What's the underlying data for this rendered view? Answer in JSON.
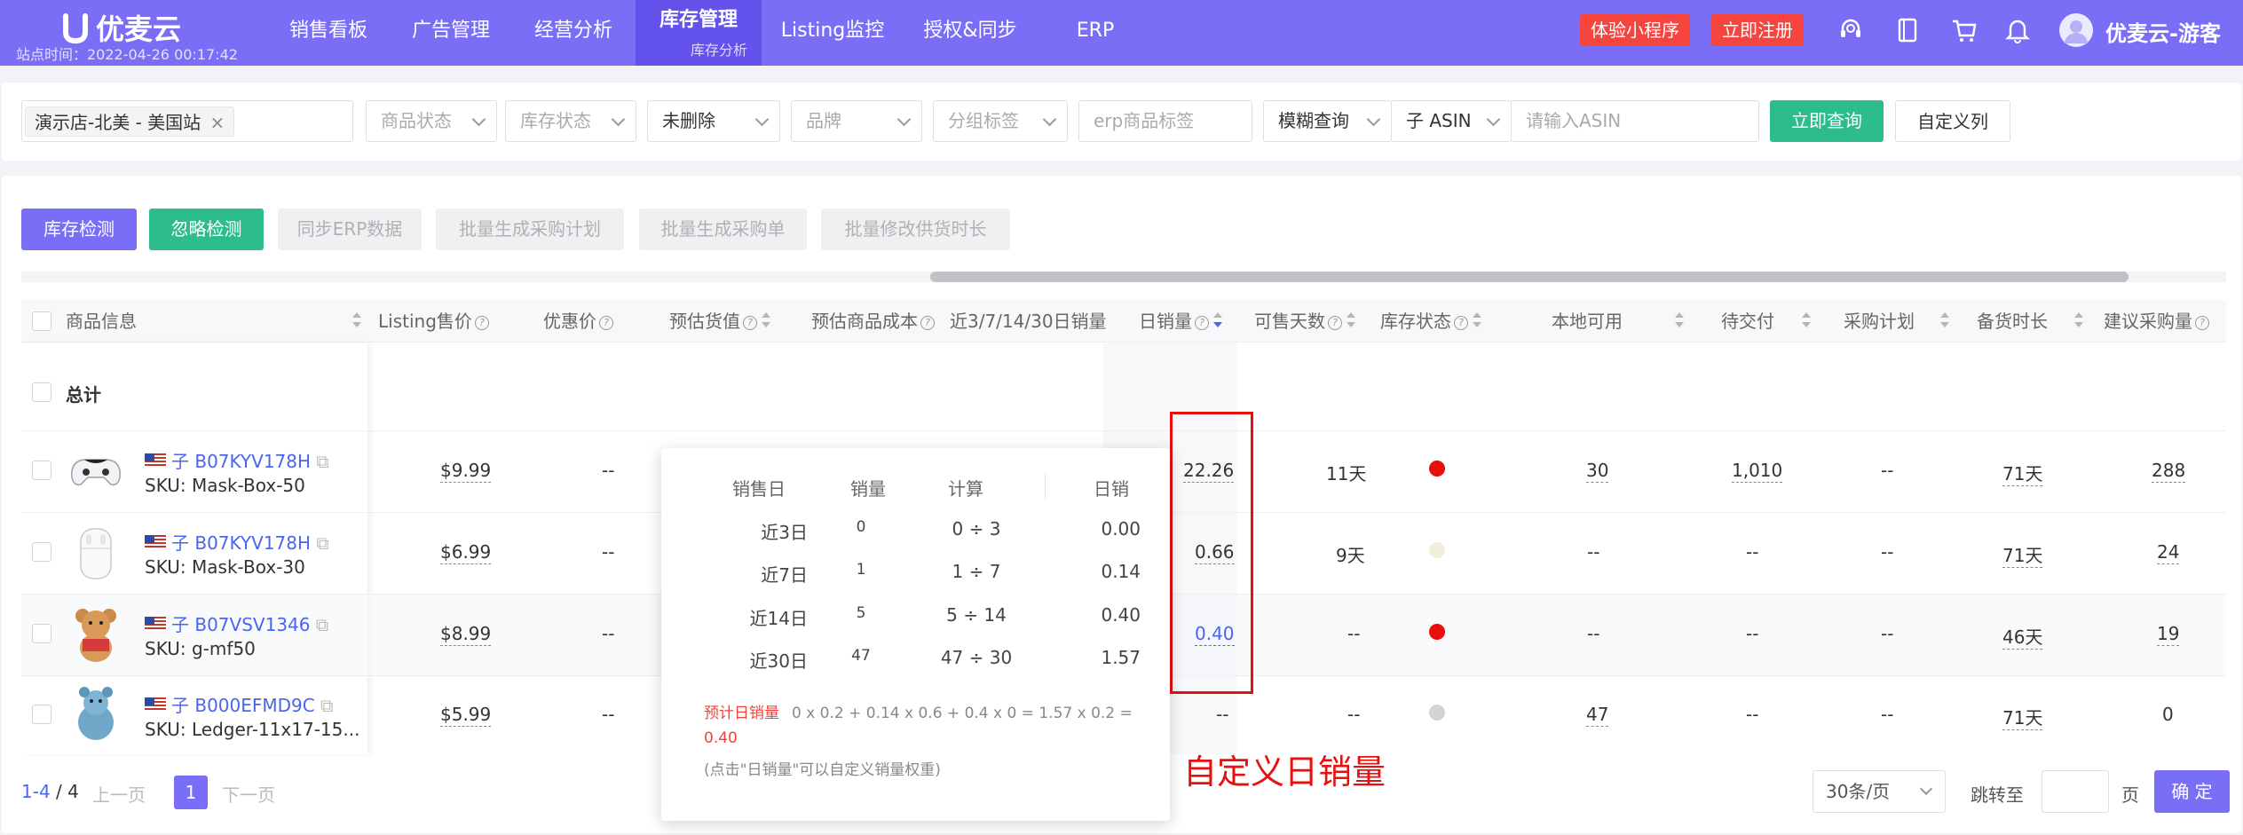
{
  "app": {
    "logo": "优麦云",
    "site_time": "站点时间：2022-04-26 00:17:42"
  },
  "nav": {
    "items": [
      "销售看板",
      "广告管理",
      "经营分析",
      "库存管理",
      "Listing监控",
      "授权&同步",
      "ERP"
    ],
    "active_sub": "库存分析",
    "trial": "体验小程序",
    "register": "立即注册",
    "user": "优麦云-游客"
  },
  "filters": {
    "store_tag": "演示店-北美 - 美国站",
    "product_status": "商品状态",
    "stock_status": "库存状态",
    "deleted": "未删除",
    "brand": "品牌",
    "group_tag": "分组标签",
    "erp_tag": "erp商品标签",
    "fuzzy": "模糊查询",
    "asin_type": "子 ASIN",
    "asin_placeholder": "请输入ASIN",
    "query": "立即查询",
    "custom_cols": "自定义列"
  },
  "actions": {
    "check": "库存检测",
    "ignore": "忽略检测",
    "sync": "同步ERP数据",
    "plan": "批量生成采购计划",
    "order": "批量生成采购单",
    "lead": "批量修改供货时长"
  },
  "table": {
    "headers": {
      "product": "商品信息",
      "price": "Listing售价",
      "discount": "优惠价",
      "est_value": "预估货值",
      "est_cost": "预估商品成本",
      "sales_hist": "近3/7/14/30日销量",
      "daily": "日销量",
      "days": "可售天数",
      "stock_status": "库存状态",
      "local": "本地可用",
      "pending": "待交付",
      "purchase": "采购计划",
      "lead_time": "备货时长",
      "suggest": "建议采购量"
    },
    "total_label": "总计",
    "rows": [
      {
        "type": "子",
        "asin": "B07KYV178H",
        "sku": "SKU: Mask-Box-50",
        "price": "$9.99",
        "discount": "--",
        "daily": "22.26",
        "days": "11天",
        "status_color": "#e8100f",
        "local": "30",
        "pending": "1,010",
        "purchase": "--",
        "lead": "71天",
        "suggest": "288"
      },
      {
        "type": "子",
        "asin": "B07KYV178H",
        "sku": "SKU: Mask-Box-30",
        "price": "$6.99",
        "discount": "--",
        "daily": "0.66",
        "days": "9天",
        "status_color": "#f2f0dc",
        "local": "--",
        "pending": "--",
        "purchase": "--",
        "lead": "71天",
        "suggest": "24"
      },
      {
        "type": "子",
        "asin": "B07VSV1346",
        "sku": "SKU: g-mf50",
        "price": "$8.99",
        "discount": "--",
        "daily": "0.40",
        "days": "--",
        "status_color": "#e8100f",
        "local": "--",
        "pending": "--",
        "purchase": "--",
        "lead": "46天",
        "suggest": "19"
      },
      {
        "type": "子",
        "asin": "B000EFMD9C",
        "sku": "SKU: Ledger-11x17-15...",
        "price": "$5.99",
        "discount": "--",
        "daily": "--",
        "days": "--",
        "status_color": "#d4d4d4",
        "local": "47",
        "pending": "--",
        "purchase": "--",
        "lead": "71天",
        "suggest": "0"
      }
    ]
  },
  "popover": {
    "headers": [
      "销售日",
      "销量",
      "计算",
      "日销"
    ],
    "rows": [
      [
        "近3日",
        "0",
        "0 ÷ 3",
        "0.00"
      ],
      [
        "近7日",
        "1",
        "1 ÷ 7",
        "0.14"
      ],
      [
        "近14日",
        "5",
        "5 ÷ 14",
        "0.40"
      ],
      [
        "近30日",
        "47",
        "47 ÷ 30",
        "1.57"
      ]
    ],
    "est_label": "预计日销量",
    "formula": "0 x 0.2 + 0.14 x 0.6 + 0.4 x 0 = 1.57 x 0.2 =",
    "result": "0.40",
    "hint": "(点击\"日销量\"可以自定义销量权重)"
  },
  "annotation": "自定义日销量",
  "pagination": {
    "range": "1-4",
    "total": "/ 4",
    "prev": "上一页",
    "page": "1",
    "next": "下一页",
    "page_size": "30条/页",
    "jump": "跳转至",
    "unit": "页",
    "confirm": "确 定"
  }
}
